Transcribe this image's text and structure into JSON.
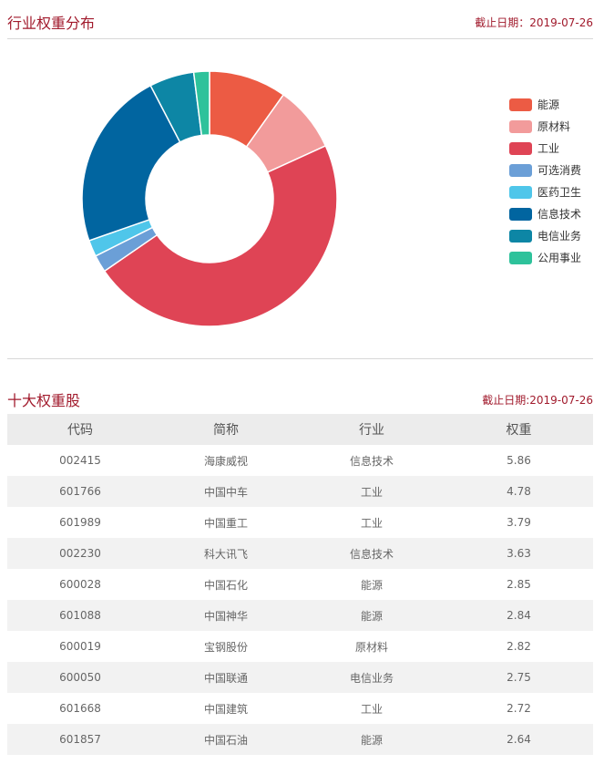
{
  "section1": {
    "title": "行业权重分布",
    "date": "截止日期：2019-07-26"
  },
  "section2": {
    "title": "十大权重股",
    "date": "截止日期:2019-07-26"
  },
  "chart_data": {
    "type": "pie",
    "categories": [
      "能源",
      "原材料",
      "工业",
      "可选消费",
      "医药卫生",
      "信息技术",
      "电信业务",
      "公用事业"
    ],
    "values": [
      9.9,
      8.4,
      47.5,
      2.2,
      2.1,
      22.8,
      5.7,
      2.0
    ],
    "colors": [
      "#ec5b44",
      "#f29b9b",
      "#df4455",
      "#6b9fd7",
      "#4fc6ea",
      "#0165a0",
      "#0d86a5",
      "#2ec29b"
    ],
    "legend_position": "right",
    "hole": "donut"
  },
  "table": {
    "headers": [
      "代码",
      "简称",
      "行业",
      "权重"
    ],
    "rows": [
      [
        "002415",
        "海康威视",
        "信息技术",
        "5.86"
      ],
      [
        "601766",
        "中国中车",
        "工业",
        "4.78"
      ],
      [
        "601989",
        "中国重工",
        "工业",
        "3.79"
      ],
      [
        "002230",
        "科大讯飞",
        "信息技术",
        "3.63"
      ],
      [
        "600028",
        "中国石化",
        "能源",
        "2.85"
      ],
      [
        "601088",
        "中国神华",
        "能源",
        "2.84"
      ],
      [
        "600019",
        "宝钢股份",
        "原材料",
        "2.82"
      ],
      [
        "600050",
        "中国联通",
        "电信业务",
        "2.75"
      ],
      [
        "601668",
        "中国建筑",
        "工业",
        "2.72"
      ],
      [
        "601857",
        "中国石油",
        "能源",
        "2.64"
      ]
    ]
  }
}
